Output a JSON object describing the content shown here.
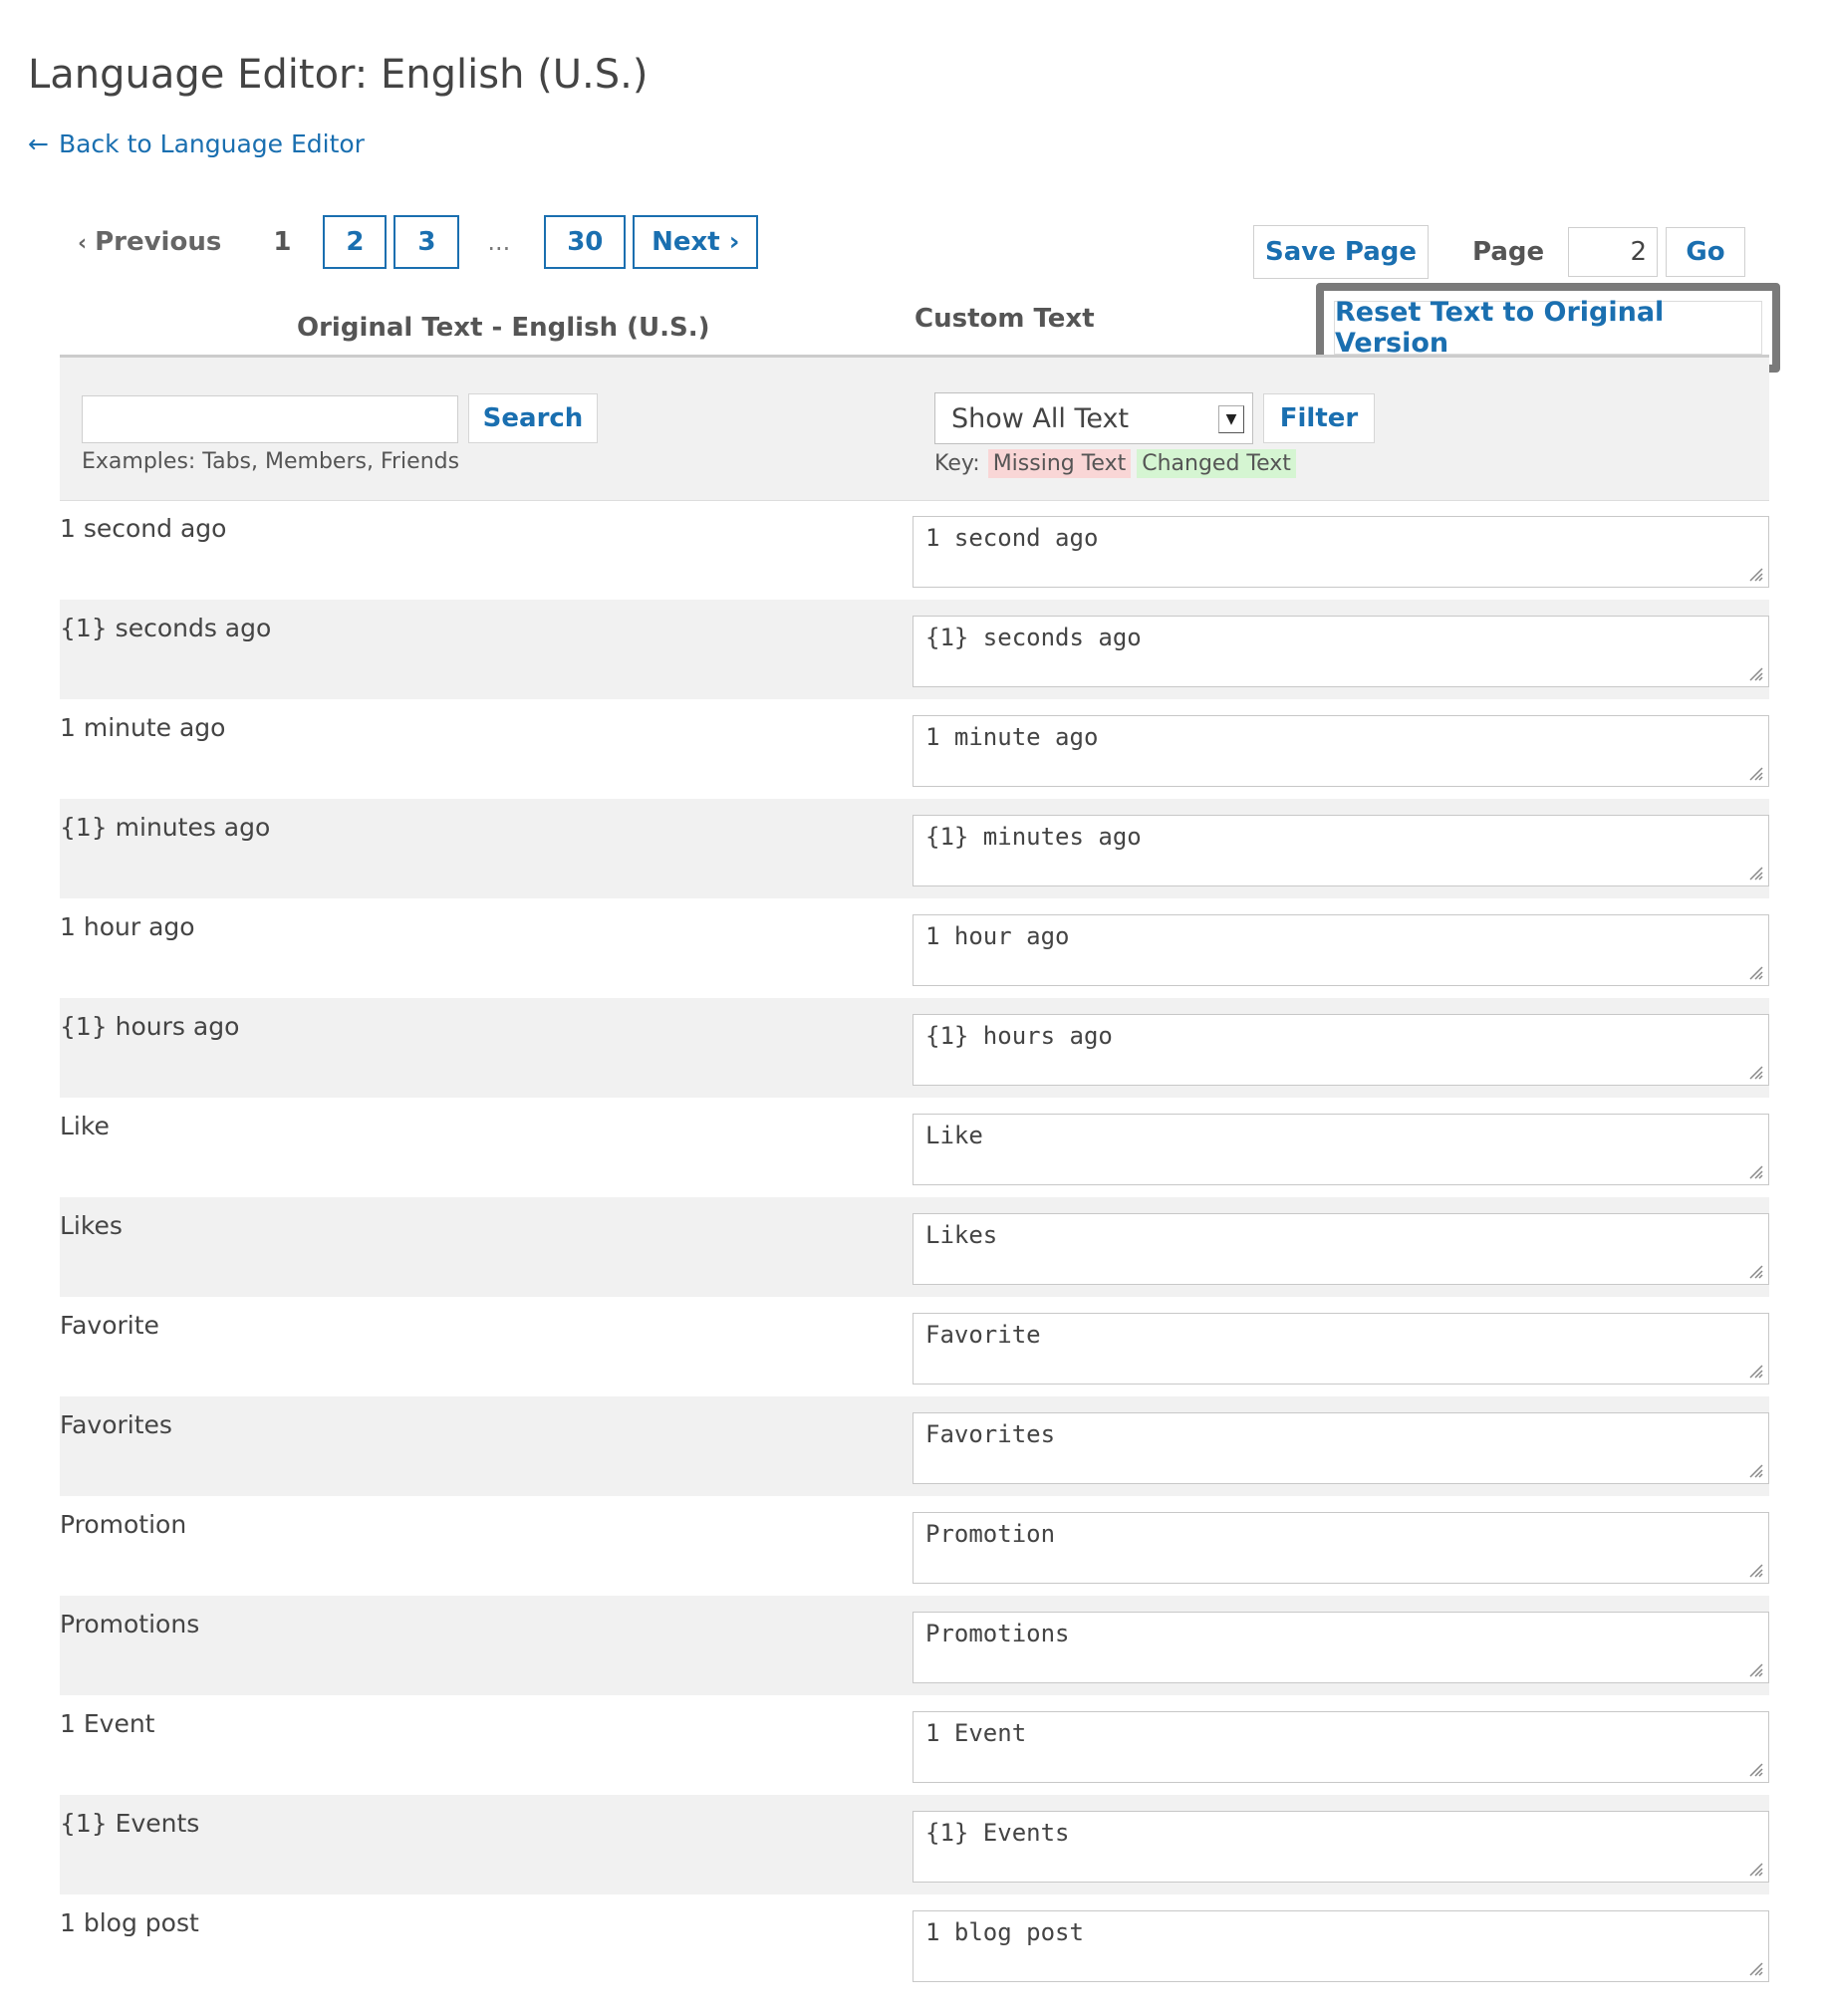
{
  "page": {
    "title": "Language Editor: English (U.S.)",
    "back_link": "Back to Language Editor",
    "back_arrow": "←"
  },
  "pagination": {
    "previous": "Previous",
    "current": "1",
    "pages": [
      "2",
      "3"
    ],
    "ellipsis": "...",
    "last": "30",
    "next": "Next"
  },
  "controls": {
    "save_page": "Save Page",
    "page_label": "Page",
    "page_value": "2",
    "go": "Go",
    "reset": "Reset Text to Original Version"
  },
  "columns": {
    "original": "Original Text - English (U.S.)",
    "custom": "Custom Text"
  },
  "filter": {
    "search_placeholder": "",
    "search_button": "Search",
    "examples": "Examples: Tabs, Members, Friends",
    "select_value": "Show All Text",
    "filter_button": "Filter",
    "key_label": "Key:",
    "key_missing": "Missing Text",
    "key_changed": "Changed Text"
  },
  "rows": [
    {
      "original": "1 second ago",
      "custom": "1 second ago"
    },
    {
      "original": "{1} seconds ago",
      "custom": "{1} seconds ago"
    },
    {
      "original": "1 minute ago",
      "custom": "1 minute ago"
    },
    {
      "original": "{1} minutes ago",
      "custom": "{1} minutes ago"
    },
    {
      "original": "1 hour ago",
      "custom": "1 hour ago"
    },
    {
      "original": "{1} hours ago",
      "custom": "{1} hours ago"
    },
    {
      "original": "Like",
      "custom": "Like"
    },
    {
      "original": "Likes",
      "custom": "Likes"
    },
    {
      "original": "Favorite",
      "custom": "Favorite"
    },
    {
      "original": "Favorites",
      "custom": "Favorites"
    },
    {
      "original": "Promotion",
      "custom": "Promotion"
    },
    {
      "original": "Promotions",
      "custom": "Promotions"
    },
    {
      "original": "1 Event",
      "custom": "1 Event"
    },
    {
      "original": "{1} Events",
      "custom": "{1} Events"
    },
    {
      "original": "1 blog post",
      "custom": "1 blog post"
    }
  ]
}
